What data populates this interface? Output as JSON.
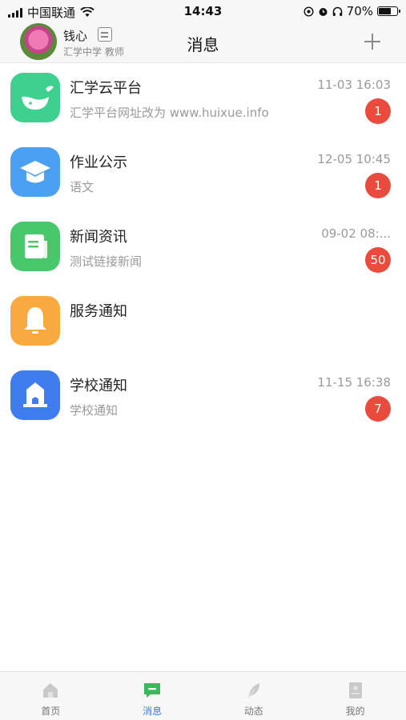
{
  "status_bar": {
    "carrier": "中国联通",
    "time": "14:43",
    "battery": "70%",
    "battery_level": 0.7
  },
  "header": {
    "user_name": "钱心",
    "user_subtitle": "汇学中学 教师",
    "title": "消息"
  },
  "messages": [
    {
      "title": "汇学云平台",
      "time": "11-03 16:03",
      "preview": "汇学平台网址改为 www.huixue.info",
      "badge": "1",
      "icon": "whale-cloud-icon"
    },
    {
      "title": "作业公示",
      "time": "12-05 10:45",
      "preview": "语文",
      "badge": "1",
      "icon": "graduation-cap-icon"
    },
    {
      "title": "新闻资讯",
      "time": "09-02 08:...",
      "preview": "测试链接新闻",
      "badge": "50",
      "icon": "newspaper-icon"
    },
    {
      "title": "服务通知",
      "time": "",
      "preview": "",
      "badge": "",
      "icon": "bell-icon"
    },
    {
      "title": "学校通知",
      "time": "11-15 16:38",
      "preview": "学校通知",
      "badge": "7",
      "icon": "school-building-icon"
    }
  ],
  "tabs": [
    {
      "label": "首页",
      "icon": "home-icon",
      "active": false
    },
    {
      "label": "消息",
      "icon": "chat-icon",
      "active": true
    },
    {
      "label": "动态",
      "icon": "feather-icon",
      "active": false
    },
    {
      "label": "我的",
      "icon": "profile-icon",
      "active": false
    }
  ],
  "colors": {
    "badge": "#ea4b3c",
    "active_tab": "#3a7cd8",
    "cloud_icon_bg": "#3fcf8e",
    "homework_icon_bg": "#4aa0f2",
    "news_icon_bg": "#48c86a",
    "service_icon_bg": "#f8a93f",
    "school_icon_bg": "#3f7cf0"
  }
}
